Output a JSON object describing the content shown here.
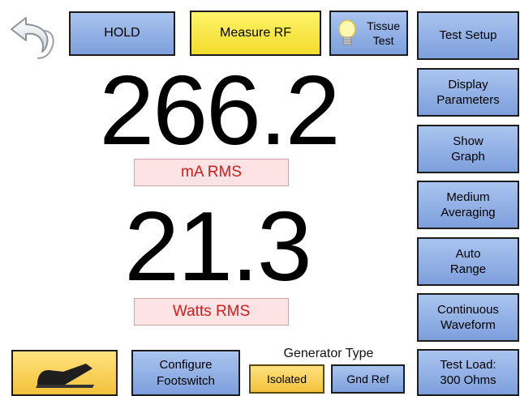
{
  "toolbar": {
    "back_icon": "back-arrow-icon",
    "hold_label": "HOLD",
    "measure_label": "Measure RF",
    "tissue_icon": "lightbulb-icon",
    "tissue_line1": "Tissue",
    "tissue_line2": "Test"
  },
  "readings": {
    "current_value": "266.2",
    "current_unit": "mA RMS",
    "power_value": "21.3",
    "power_unit": "Watts RMS"
  },
  "sidebar": {
    "test_setup": "Test Setup",
    "display_line1": "Display",
    "display_line2": "Parameters",
    "graph_line1": "Show",
    "graph_line2": "Graph",
    "averaging_line1": "Medium",
    "averaging_line2": "Averaging",
    "range_line1": "Auto",
    "range_line2": "Range",
    "waveform_line1": "Continuous",
    "waveform_line2": "Waveform",
    "load_line1": "Test Load:",
    "load_line2": "300 Ohms"
  },
  "bottom": {
    "footswitch_icon": "footswitch-pedal-icon",
    "configure_line1": "Configure",
    "configure_line2": "Footswitch",
    "generator_type_label": "Generator Type",
    "isolated_label": "Isolated",
    "gnd_ref_label": "Gnd Ref"
  },
  "colors": {
    "blue_button": "#8fb0e6",
    "yellow_button": "#f8e84a",
    "active_gold": "#f7cc4a",
    "unit_background": "#fde3e3",
    "unit_text": "#cc1f1f"
  }
}
